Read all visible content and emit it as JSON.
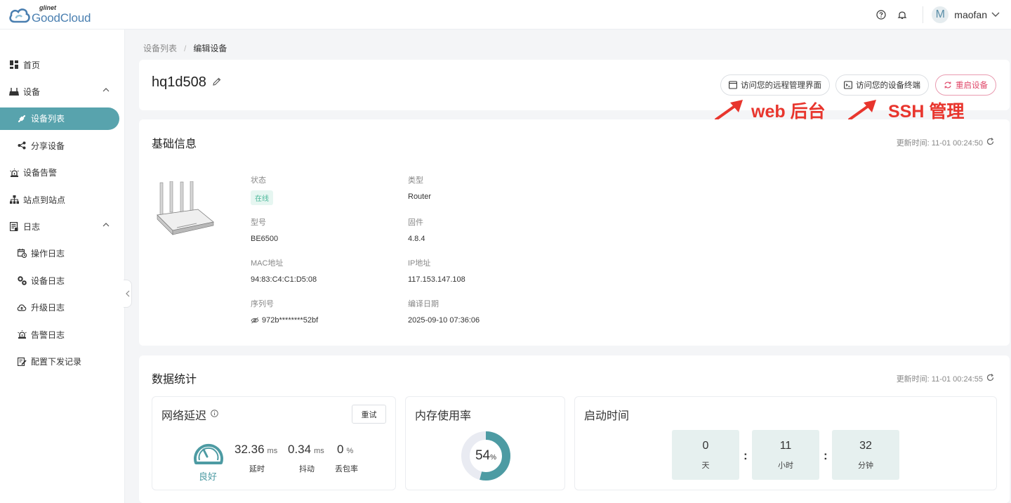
{
  "header": {
    "logo_small": "glinet",
    "logo_big": "GoodCloud",
    "user_initial": "M",
    "username": "maofan",
    "icons": [
      "help-circle-icon",
      "bell-icon",
      "chevron-down-icon"
    ]
  },
  "sidebar": {
    "items": [
      {
        "label": "首页",
        "icon": "dashboard-icon"
      },
      {
        "label": "设备",
        "icon": "router-icon",
        "expanded": true
      },
      {
        "label": "设备列表",
        "icon": "link-icon",
        "active": true
      },
      {
        "label": "分享设备",
        "icon": "share-icon"
      },
      {
        "label": "设备告警",
        "icon": "alarm-icon"
      },
      {
        "label": "站点到站点",
        "icon": "sitemap-icon"
      },
      {
        "label": "日志",
        "icon": "log-icon",
        "expanded": true
      },
      {
        "label": "操作日志",
        "icon": "calendar-clock-icon"
      },
      {
        "label": "设备日志",
        "icon": "gears-icon"
      },
      {
        "label": "升级日志",
        "icon": "cloud-upload-icon"
      },
      {
        "label": "告警日志",
        "icon": "alarm-icon"
      },
      {
        "label": "配置下发记录",
        "icon": "edit-doc-icon"
      }
    ]
  },
  "breadcrumb": {
    "parent": "设备列表",
    "separator": "/",
    "current": "编辑设备"
  },
  "device": {
    "name": "hq1d508",
    "btn_web": "访问您的远程管理界面",
    "btn_ssh": "访问您的设备终端",
    "btn_reboot": "重启设备"
  },
  "annotations": {
    "web": "web 后台",
    "ssh": "SSH 管理"
  },
  "info": {
    "title": "基础信息",
    "updated": "更新时间: 11-01 00:24:50",
    "status_label": "状态",
    "status_value": "在线",
    "type_label": "类型",
    "type_value": "Router",
    "model_label": "型号",
    "model_value": "BE6500",
    "firmware_label": "固件",
    "firmware_value": "4.8.4",
    "mac_label": "MAC地址",
    "mac_value": "94:83:C4:C1:D5:08",
    "ip_label": "IP地址",
    "ip_value": "117.153.147.108",
    "sn_label": "序列号",
    "sn_value": "972b********52bf",
    "build_label": "编译日期",
    "build_value": "2025-09-10 07:36:06"
  },
  "stats": {
    "title": "数据统计",
    "updated": "更新时间: 11-01 00:24:55",
    "latency": {
      "title": "网络延迟",
      "retry": "重试",
      "quality": "良好",
      "delay_value": "32.36",
      "delay_unit": "ms",
      "delay_label": "延时",
      "jitter_value": "0.34",
      "jitter_unit": "ms",
      "jitter_label": "抖动",
      "loss_value": "0",
      "loss_unit": "%",
      "loss_label": "丢包率"
    },
    "memory": {
      "title": "内存使用率",
      "value": "54",
      "unit": "%",
      "percent": 54
    },
    "uptime": {
      "title": "启动时间",
      "days": "0",
      "days_label": "天",
      "hours": "11",
      "hours_label": "小时",
      "minutes": "32",
      "minutes_label": "分钟",
      "colon": ":"
    }
  },
  "colors": {
    "accent": "#58a3ad",
    "danger": "#e04a6b",
    "annotation": "#e8352d"
  }
}
